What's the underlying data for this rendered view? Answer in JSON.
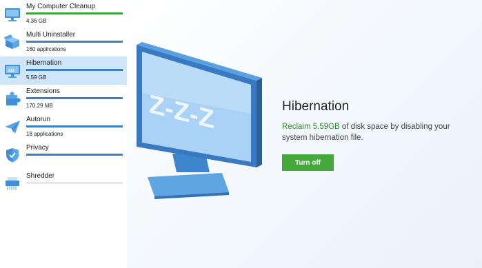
{
  "sidebar": {
    "items": [
      {
        "name": "My Computer Cleanup",
        "sub": "4.36 GB",
        "icon": "computer-icon",
        "fill": 1.0,
        "color": "#3aa63a"
      },
      {
        "name": "Multi Uninstaller",
        "sub": "160 applications",
        "icon": "box-icon",
        "fill": 1.0,
        "color": "#3b7fc4"
      },
      {
        "name": "Hibernation",
        "sub": "5.59 GB",
        "icon": "hibernation-monitor-icon",
        "fill": 1.0,
        "color": "#3b7fc4"
      },
      {
        "name": "Extensions",
        "sub": "170.29 MB",
        "icon": "puzzle-icon",
        "fill": 1.0,
        "color": "#3b7fc4"
      },
      {
        "name": "Autorun",
        "sub": "18 applications",
        "icon": "paper-plane-icon",
        "fill": 1.0,
        "color": "#3b7fc4"
      },
      {
        "name": "Privacy",
        "sub": "",
        "icon": "shield-icon",
        "fill": 1.0,
        "color": "#3b7fc4"
      },
      {
        "name": "Shredder",
        "sub": "",
        "icon": "shredder-icon",
        "fill": 0,
        "color": "#3b7fc4"
      }
    ]
  },
  "main": {
    "title": "Hibernation",
    "highlight": "Reclaim 5.59GB",
    "description": " of disk space by disabling your system hibernation file.",
    "button": "Turn off",
    "screen_text": "Z-Z-Z",
    "icon": "sleeping-monitor-icon"
  }
}
